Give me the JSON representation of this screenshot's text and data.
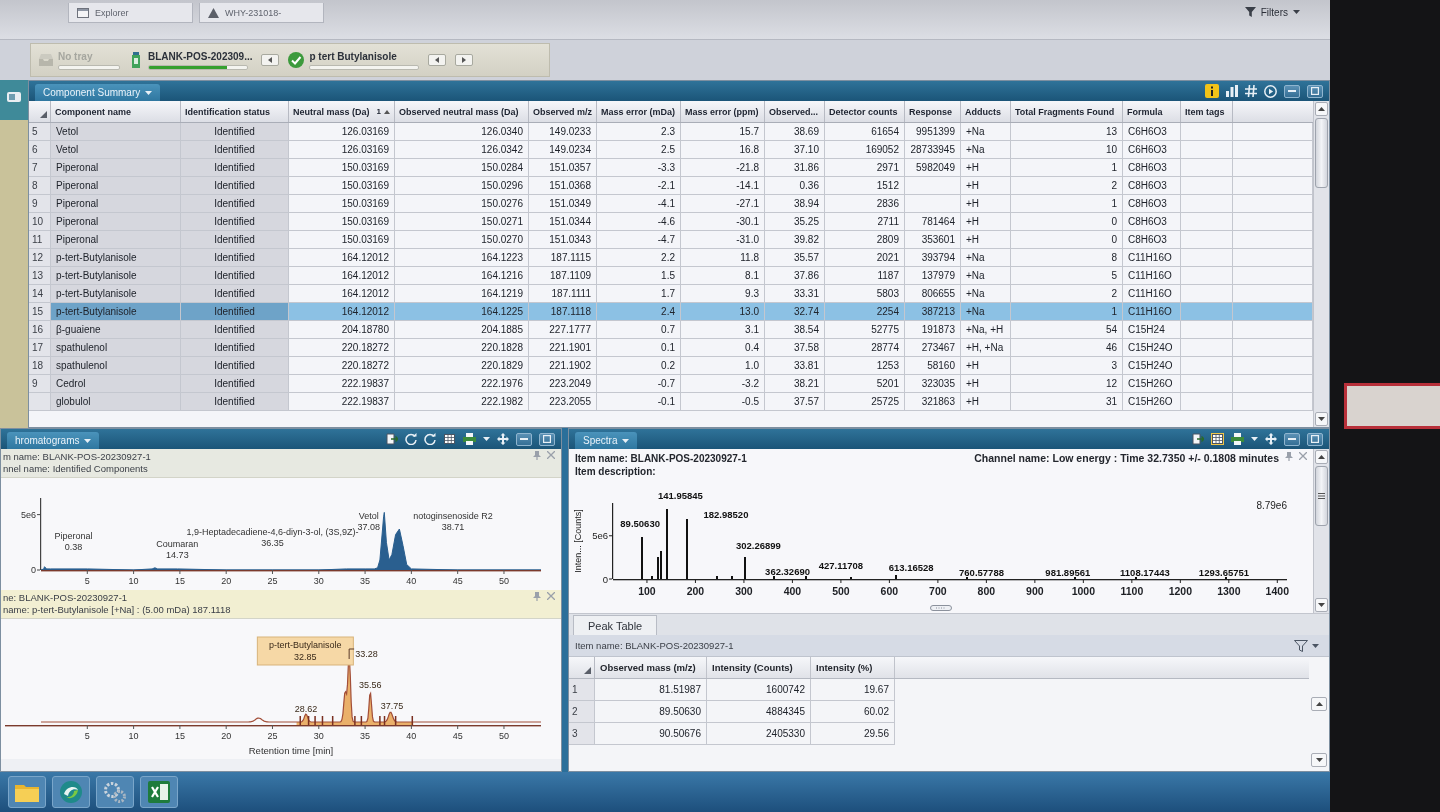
{
  "top_bar": {
    "tabs": [
      {
        "kind": "explorer",
        "label": "Explorer"
      },
      {
        "kind": "warning",
        "label": "WHY-231018-"
      }
    ],
    "filters": "Filters"
  },
  "sample_bar": {
    "tray": {
      "label": "No tray",
      "disabled": true
    },
    "sample": {
      "label": "BLANK-POS-202309...",
      "level": 0.8
    },
    "component": {
      "label": "p tert Butylanisole",
      "identified": true
    }
  },
  "component_summary": {
    "title": "Component Summary",
    "columns": [
      {
        "label": "Component name",
        "sorted": false
      },
      {
        "label": "Identification status",
        "sorted": false
      },
      {
        "label": "Neutral mass (Da)",
        "sorted": true,
        "sort_rank": "1"
      },
      {
        "label": "Observed neutral mass (Da)",
        "sorted": false
      },
      {
        "label": "Observed m/z",
        "sorted": false
      },
      {
        "label": "Mass error (mDa)",
        "sorted": false
      },
      {
        "label": "Mass error (ppm)",
        "sorted": false
      },
      {
        "label": "Observed...",
        "sorted": false
      },
      {
        "label": "Detector counts",
        "sorted": false
      },
      {
        "label": "Response",
        "sorted": false
      },
      {
        "label": "Adducts",
        "sorted": false
      },
      {
        "label": "Total Fragments Found",
        "sorted": false
      },
      {
        "label": "Formula",
        "sorted": false
      },
      {
        "label": "Item tags",
        "sorted": false
      }
    ],
    "rows": [
      {
        "number": "5",
        "name": "Vetol",
        "status": "Identified",
        "neutral_mass": "126.03169",
        "observed_neutral_mass": "126.0340",
        "observed_mz": "149.0233",
        "mass_error_mda": "2.3",
        "mass_error_ppm": "15.7",
        "observed_rt": "38.69",
        "detector_counts": "61654",
        "response": "9951399",
        "adducts": "+Na",
        "total_fragments": "13",
        "formula": "C6H6O3",
        "selected": false
      },
      {
        "number": "6",
        "name": "Vetol",
        "status": "Identified",
        "neutral_mass": "126.03169",
        "observed_neutral_mass": "126.0342",
        "observed_mz": "149.0234",
        "mass_error_mda": "2.5",
        "mass_error_ppm": "16.8",
        "observed_rt": "37.10",
        "detector_counts": "169052",
        "response": "28733945",
        "adducts": "+Na",
        "total_fragments": "10",
        "formula": "C6H6O3",
        "selected": false
      },
      {
        "number": "7",
        "name": "Piperonal",
        "status": "Identified",
        "neutral_mass": "150.03169",
        "observed_neutral_mass": "150.0284",
        "observed_mz": "151.0357",
        "mass_error_mda": "-3.3",
        "mass_error_ppm": "-21.8",
        "observed_rt": "31.86",
        "detector_counts": "2971",
        "response": "5982049",
        "adducts": "+H",
        "total_fragments": "1",
        "formula": "C8H6O3",
        "selected": false
      },
      {
        "number": "8",
        "name": "Piperonal",
        "status": "Identified",
        "neutral_mass": "150.03169",
        "observed_neutral_mass": "150.0296",
        "observed_mz": "151.0368",
        "mass_error_mda": "-2.1",
        "mass_error_ppm": "-14.1",
        "observed_rt": "0.36",
        "detector_counts": "1512",
        "adducts": "+H",
        "total_fragments": "2",
        "formula": "C8H6O3",
        "selected": false
      },
      {
        "number": "9",
        "name": "Piperonal",
        "status": "Identified",
        "neutral_mass": "150.03169",
        "observed_neutral_mass": "150.0276",
        "observed_mz": "151.0349",
        "mass_error_mda": "-4.1",
        "mass_error_ppm": "-27.1",
        "observed_rt": "38.94",
        "detector_counts": "2836",
        "adducts": "+H",
        "total_fragments": "1",
        "formula": "C8H6O3",
        "selected": false
      },
      {
        "number": "10",
        "name": "Piperonal",
        "status": "Identified",
        "neutral_mass": "150.03169",
        "observed_neutral_mass": "150.0271",
        "observed_mz": "151.0344",
        "mass_error_mda": "-4.6",
        "mass_error_ppm": "-30.1",
        "observed_rt": "35.25",
        "detector_counts": "2711",
        "response": "781464",
        "adducts": "+H",
        "total_fragments": "0",
        "formula": "C8H6O3",
        "selected": false
      },
      {
        "number": "11",
        "name": "Piperonal",
        "status": "Identified",
        "neutral_mass": "150.03169",
        "observed_neutral_mass": "150.0270",
        "observed_mz": "151.0343",
        "mass_error_mda": "-4.7",
        "mass_error_ppm": "-31.0",
        "observed_rt": "39.82",
        "detector_counts": "2809",
        "response": "353601",
        "adducts": "+H",
        "total_fragments": "0",
        "formula": "C8H6O3",
        "selected": false
      },
      {
        "number": "12",
        "name": "p-tert-Butylanisole",
        "status": "Identified",
        "neutral_mass": "164.12012",
        "observed_neutral_mass": "164.1223",
        "observed_mz": "187.1115",
        "mass_error_mda": "2.2",
        "mass_error_ppm": "11.8",
        "observed_rt": "35.57",
        "detector_counts": "2021",
        "response": "393794",
        "adducts": "+Na",
        "total_fragments": "8",
        "formula": "C11H16O",
        "selected": false
      },
      {
        "number": "13",
        "name": "p-tert-Butylanisole",
        "status": "Identified",
        "neutral_mass": "164.12012",
        "observed_neutral_mass": "164.1216",
        "observed_mz": "187.1109",
        "mass_error_mda": "1.5",
        "mass_error_ppm": "8.1",
        "observed_rt": "37.86",
        "detector_counts": "1187",
        "response": "137979",
        "adducts": "+Na",
        "total_fragments": "5",
        "formula": "C11H16O",
        "selected": false
      },
      {
        "number": "14",
        "name": "p-tert-Butylanisole",
        "status": "Identified",
        "neutral_mass": "164.12012",
        "observed_neutral_mass": "164.1219",
        "observed_mz": "187.1111",
        "mass_error_mda": "1.7",
        "mass_error_ppm": "9.3",
        "observed_rt": "33.31",
        "detector_counts": "5803",
        "response": "806655",
        "adducts": "+Na",
        "total_fragments": "2",
        "formula": "C11H16O",
        "selected": false
      },
      {
        "number": "15",
        "name": "p-tert-Butylanisole",
        "status": "Identified",
        "neutral_mass": "164.12012",
        "observed_neutral_mass": "164.1225",
        "observed_mz": "187.1118",
        "mass_error_mda": "2.4",
        "mass_error_ppm": "13.0",
        "observed_rt": "32.74",
        "detector_counts": "2254",
        "response": "387213",
        "adducts": "+Na",
        "total_fragments": "1",
        "formula": "C11H16O",
        "selected": true
      },
      {
        "number": "16",
        "name": "β-guaiene",
        "status": "Identified",
        "neutral_mass": "204.18780",
        "observed_neutral_mass": "204.1885",
        "observed_mz": "227.1777",
        "mass_error_mda": "0.7",
        "mass_error_ppm": "3.1",
        "observed_rt": "38.54",
        "detector_counts": "52775",
        "response": "191873",
        "adducts": "+Na, +H",
        "total_fragments": "54",
        "formula": "C15H24",
        "selected": false
      },
      {
        "number": "17",
        "name": "spathulenol",
        "status": "Identified",
        "neutral_mass": "220.18272",
        "observed_neutral_mass": "220.1828",
        "observed_mz": "221.1901",
        "mass_error_mda": "0.1",
        "mass_error_ppm": "0.4",
        "observed_rt": "37.58",
        "detector_counts": "28774",
        "response": "273467",
        "adducts": "+H, +Na",
        "total_fragments": "46",
        "formula": "C15H24O",
        "selected": false
      },
      {
        "number": "18",
        "name": "spathulenol",
        "status": "Identified",
        "neutral_mass": "220.18272",
        "observed_neutral_mass": "220.1829",
        "observed_mz": "221.1902",
        "mass_error_mda": "0.2",
        "mass_error_ppm": "1.0",
        "observed_rt": "33.81",
        "detector_counts": "1253",
        "response": "58160",
        "adducts": "+H",
        "total_fragments": "3",
        "formula": "C15H24O",
        "selected": false
      },
      {
        "number": "9",
        "name": "Cedrol",
        "status": "Identified",
        "neutral_mass": "222.19837",
        "observed_neutral_mass": "222.1976",
        "observed_mz": "223.2049",
        "mass_error_mda": "-0.7",
        "mass_error_ppm": "-3.2",
        "observed_rt": "38.21",
        "detector_counts": "5201",
        "response": "323035",
        "adducts": "+H",
        "total_fragments": "12",
        "formula": "C15H26O",
        "selected": false
      },
      {
        "name": "globulol",
        "status": "Identified",
        "neutral_mass": "222.19837",
        "observed_neutral_mass": "222.1982",
        "observed_mz": "223.2055",
        "mass_error_mda": "-0.1",
        "mass_error_ppm": "-0.5",
        "observed_rt": "37.57",
        "detector_counts": "25725",
        "response": "321863",
        "adducts": "+H",
        "total_fragments": "31",
        "formula": "C15H26O",
        "selected": false
      }
    ]
  },
  "chromatograms": {
    "title": "hromatograms",
    "plots": [
      {
        "item_name": "m name: BLANK-POS-20230927-1",
        "channel_name": "nnel name: Identified Components",
        "chart_data": {
          "type": "area",
          "x": [
            0,
            0.3,
            0.38,
            0.6,
            1,
            5,
            10,
            12,
            12.3,
            12.6,
            14.73,
            20,
            25,
            30,
            33,
            35,
            36,
            36.35,
            36.6,
            37.0,
            37.08,
            37.3,
            37.6,
            37.9,
            38.3,
            38.71,
            39.1,
            39.5,
            40,
            45,
            50,
            54
          ],
          "series": [
            {
              "color": "#2a5f8f",
              "values": [
                0,
                100000,
                300000,
                100000,
                100000,
                100000,
                0,
                100000,
                200000,
                100000,
                100000,
                0,
                0,
                0,
                100000,
                100000,
                100000,
                200000,
                900000,
                4800000,
                5200000,
                2500000,
                900000,
                1400000,
                3200000,
                3700000,
                2200000,
                500000,
                100000,
                0,
                0,
                0
              ]
            }
          ],
          "xlim": [
            0,
            54
          ],
          "ylim": [
            0,
            6500000
          ],
          "xticks": [
            5,
            10,
            15,
            20,
            25,
            30,
            35,
            40,
            45,
            50
          ],
          "yticks": [
            0,
            {
              "value": 5000000,
              "label": "5e6"
            }
          ],
          "annotations": [
            "Piperonal",
            "0.38",
            "Coumaran",
            "14.73",
            "1,9-Heptadecadiene-4,6-diyn-3-ol, (3S,9Z)-",
            "36.35",
            "Vetol",
            "37.08",
            "notoginsenoside R2",
            "38.71"
          ]
        }
      },
      {
        "item_name": "ne: BLANK-POS-20230927-1",
        "channel_name": "name: p-tert-Butylanisole [+Na] : (5.00 mDa) 187.1118",
        "callout": {
          "text": "p-tert-Butylanisole",
          "value": "32.85"
        },
        "peak_labels": [
          "33.28",
          "35.56",
          "28.62",
          "37.75"
        ],
        "x_ticks": [
          "5",
          "10",
          "15",
          "20",
          "25",
          "30",
          "35",
          "40",
          "45",
          "50"
        ],
        "xlabel": "Retention time [min]"
      }
    ]
  },
  "spectra": {
    "title": "Spectra",
    "item_name": "Item name: BLANK-POS-20230927-1",
    "item_description": "Item description:",
    "channel": "Channel name: Low energy : Time 32.7350 +/- 0.1808 minutes",
    "scale_label": "8.79e6",
    "chart_data": {
      "type": "bar",
      "ylabel": "Inten... [Counts]",
      "x": [
        89.5063,
        110,
        122,
        128,
        141.95845,
        182.9852,
        245,
        275,
        302.26899,
        362.3269,
        427.11708,
        520,
        613.16528,
        760.57788,
        981.89561,
        1108.17443,
        1293.65751
      ],
      "values": [
        4900000,
        400000,
        2600000,
        3200000,
        8100000,
        6900000,
        400000,
        300000,
        2600000,
        300000,
        400000,
        200000,
        500000,
        200000,
        200000,
        200000,
        200000
      ],
      "xlim": [
        30,
        1420
      ],
      "ylim": [
        0,
        8790000
      ],
      "xticks": [
        100,
        200,
        300,
        400,
        500,
        600,
        700,
        800,
        900,
        1000,
        1100,
        1200,
        1300,
        1400
      ],
      "yticks": [
        0,
        {
          "value": 5000000,
          "label": "5e6"
        }
      ],
      "annotations": [
        "141.95845",
        "89.50630",
        "182.98520",
        "302.26899",
        "362.32690",
        "427.11708",
        "613.16528",
        "760.57788",
        "981.89561",
        "1108.17443",
        "1293.65751"
      ]
    }
  },
  "peak_table": {
    "tab": "Peak Table",
    "item_name": "Item name: BLANK-POS-20230927-1",
    "columns": [
      "Observed mass (m/z)",
      "Intensity (Counts)",
      "Intensity (%)"
    ],
    "rows": [
      {
        "number": "1",
        "cells": [
          "81.51987",
          "1600742",
          "19.67"
        ]
      },
      {
        "number": "2",
        "cells": [
          "89.50630",
          "4884345",
          "60.02"
        ]
      },
      {
        "number": "3",
        "cells": [
          "90.50676",
          "2405330",
          "29.56"
        ]
      }
    ]
  },
  "taskbar": {
    "apps": [
      {
        "kind": "folder"
      },
      {
        "kind": "browser"
      },
      {
        "kind": "settings"
      },
      {
        "kind": "spreadsheet"
      }
    ]
  }
}
